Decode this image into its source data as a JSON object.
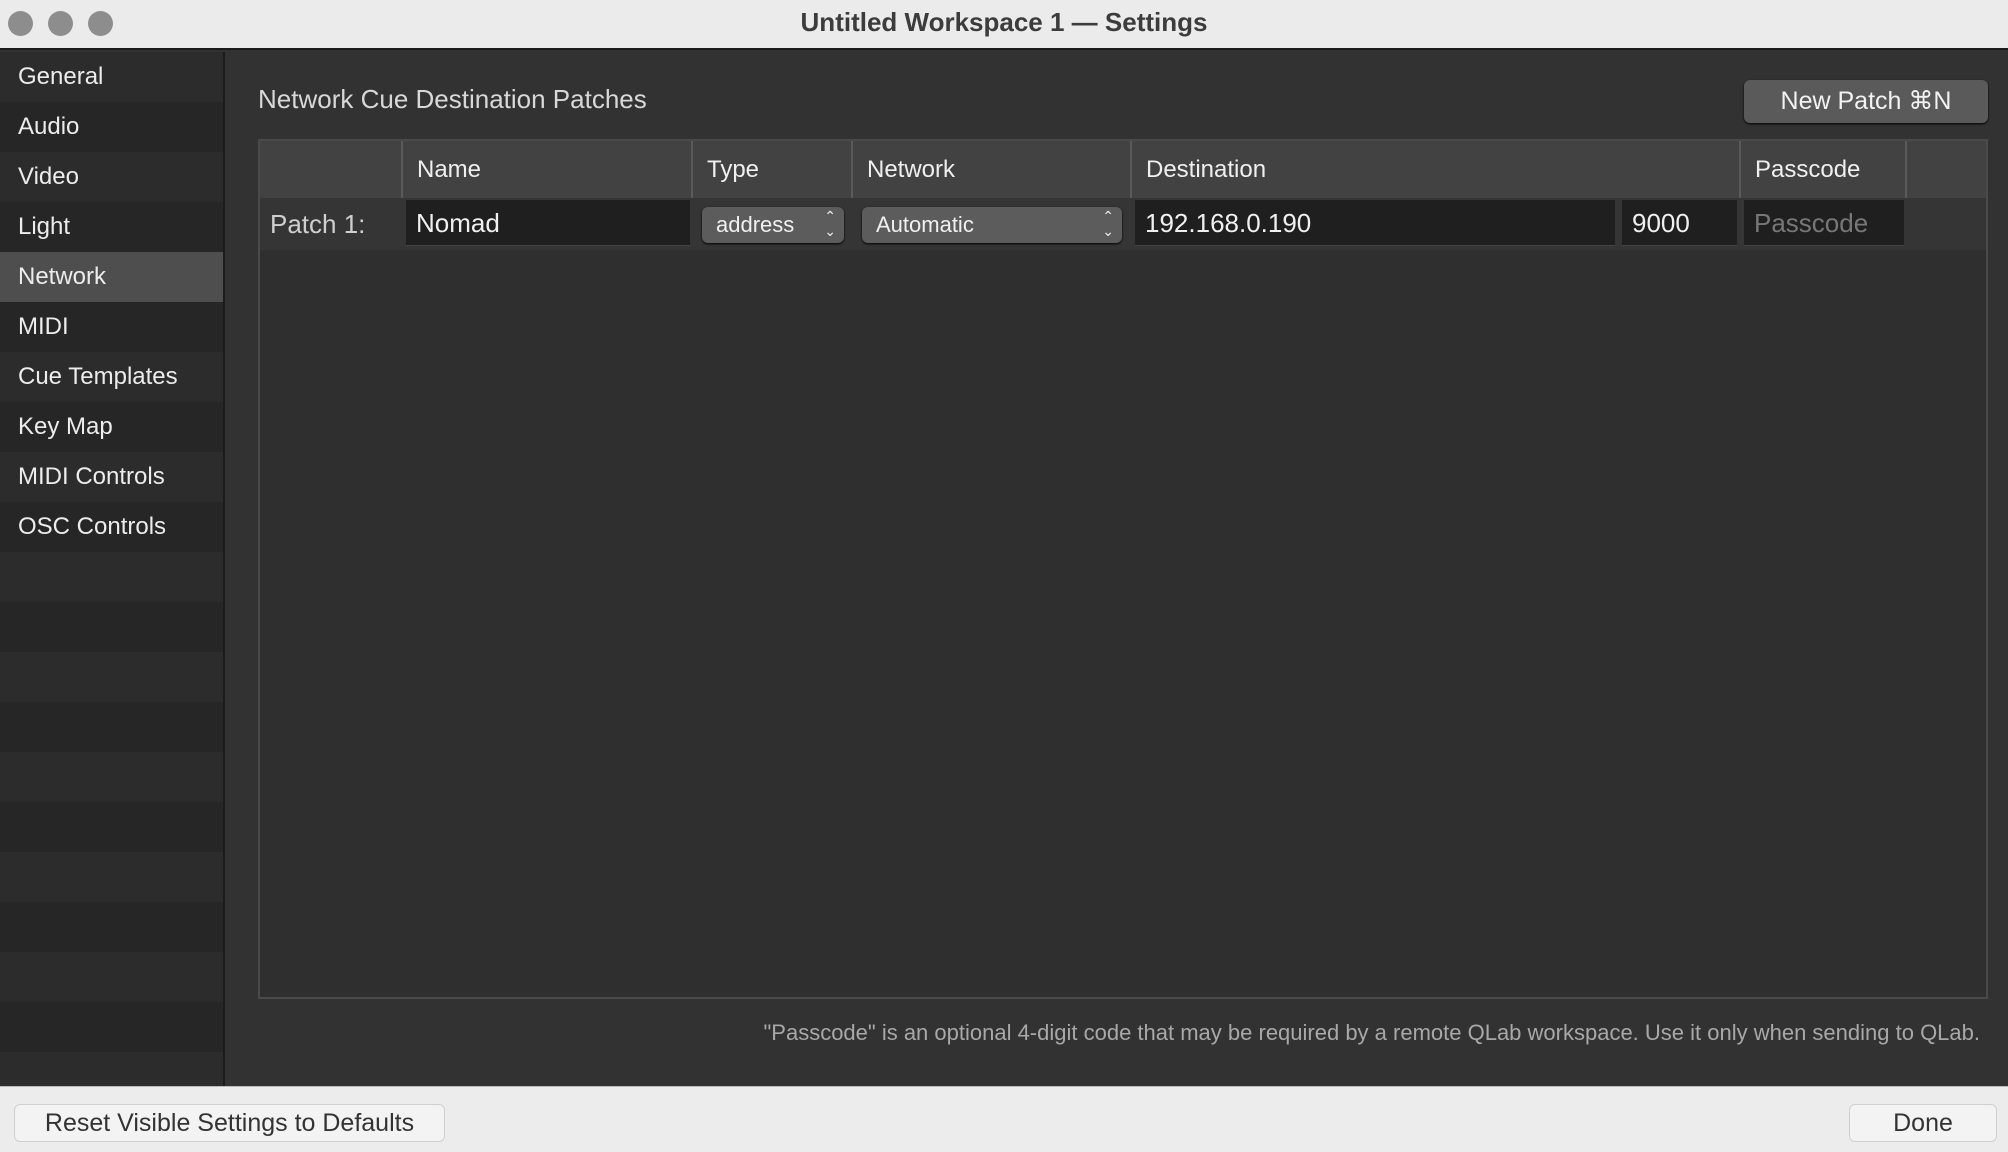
{
  "window": {
    "title": "Untitled Workspace 1 — Settings"
  },
  "sidebar": {
    "items": [
      {
        "label": "General"
      },
      {
        "label": "Audio"
      },
      {
        "label": "Video"
      },
      {
        "label": "Light"
      },
      {
        "label": "Network",
        "selected": true
      },
      {
        "label": "MIDI"
      },
      {
        "label": "Cue Templates"
      },
      {
        "label": "Key Map"
      },
      {
        "label": "MIDI Controls"
      },
      {
        "label": "OSC Controls"
      }
    ]
  },
  "main": {
    "heading": "Network Cue Destination Patches",
    "new_patch_label": "New Patch  ⌘N",
    "columns": [
      "Name",
      "Type",
      "Network",
      "Destination",
      "Passcode"
    ],
    "patches": [
      {
        "label": "Patch 1:",
        "name": "Nomad",
        "type": "address",
        "network": "Automatic",
        "destination": "192.168.0.190",
        "port": "9000",
        "passcode": "",
        "passcode_placeholder": "Passcode"
      }
    ],
    "note": "\"Passcode\" is an optional 4-digit code that may be required by a remote QLab workspace. Use it only when sending to QLab."
  },
  "footer": {
    "reset_label": "Reset Visible Settings to Defaults",
    "done_label": "Done"
  }
}
